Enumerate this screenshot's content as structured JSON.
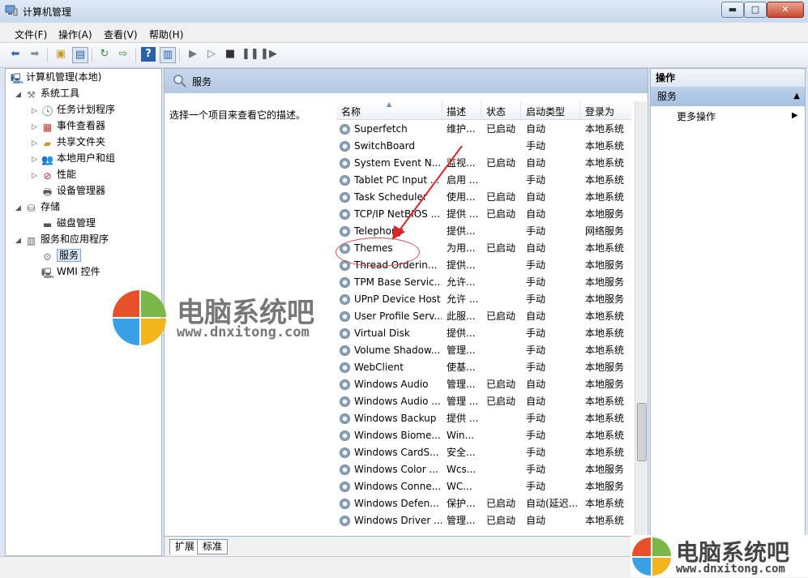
{
  "window": {
    "title": "计算机管理",
    "min_glyph": "▬",
    "max_glyph": "□",
    "close_glyph": "✕"
  },
  "menu": [
    "文件(F)",
    "操作(A)",
    "查看(V)",
    "帮助(H)"
  ],
  "tree": {
    "root": "计算机管理(本地)",
    "system_tools": "系统工具",
    "task_scheduler": "任务计划程序",
    "event_viewer": "事件查看器",
    "shared_folders": "共享文件夹",
    "local_users": "本地用户和组",
    "performance": "性能",
    "device_manager": "设备管理器",
    "storage": "存储",
    "disk_management": "磁盘管理",
    "services_apps": "服务和应用程序",
    "services": "服务",
    "wmi": "WMI 控件"
  },
  "center": {
    "header_title": "服务",
    "description": "选择一个项目来查看它的描述。",
    "columns": [
      "名称",
      "描述",
      "状态",
      "启动类型",
      "登录为"
    ],
    "rows": [
      [
        "Superfetch",
        "维护...",
        "已启动",
        "自动",
        "本地系统"
      ],
      [
        "SwitchBoard",
        "",
        "",
        "手动",
        "本地系统"
      ],
      [
        "System Event N...",
        "监视...",
        "已启动",
        "自动",
        "本地系统"
      ],
      [
        "Tablet PC Input ...",
        "启用 ...",
        "",
        "手动",
        "本地系统"
      ],
      [
        "Task Scheduler",
        "使用...",
        "已启动",
        "自动",
        "本地系统"
      ],
      [
        "TCP/IP NetBIOS ...",
        "提供 ...",
        "已启动",
        "自动",
        "本地服务"
      ],
      [
        "Telephony",
        "提供...",
        "",
        "手动",
        "网络服务"
      ],
      [
        "Themes",
        "为用...",
        "已启动",
        "自动",
        "本地系统"
      ],
      [
        "Thread Orderin...",
        "提供...",
        "",
        "手动",
        "本地服务"
      ],
      [
        "TPM Base Servic...",
        "允许...",
        "",
        "手动",
        "本地服务"
      ],
      [
        "UPnP Device Host",
        "允许 ...",
        "",
        "手动",
        "本地服务"
      ],
      [
        "User Profile Serv...",
        "此服...",
        "已启动",
        "自动",
        "本地系统"
      ],
      [
        "Virtual Disk",
        "提供...",
        "",
        "手动",
        "本地系统"
      ],
      [
        "Volume Shadow...",
        "管理...",
        "",
        "手动",
        "本地系统"
      ],
      [
        "WebClient",
        "使基...",
        "",
        "手动",
        "本地服务"
      ],
      [
        "Windows Audio",
        "管理...",
        "已启动",
        "自动",
        "本地服务"
      ],
      [
        "Windows Audio ...",
        "管理 ...",
        "已启动",
        "自动",
        "本地系统"
      ],
      [
        "Windows Backup",
        "提供 ...",
        "",
        "手动",
        "本地系统"
      ],
      [
        "Windows Biome...",
        "Win...",
        "",
        "手动",
        "本地系统"
      ],
      [
        "Windows CardS...",
        "安全...",
        "",
        "手动",
        "本地系统"
      ],
      [
        "Windows Color ...",
        "Wcs...",
        "",
        "手动",
        "本地服务"
      ],
      [
        "Windows Conne...",
        "WC...",
        "",
        "手动",
        "本地服务"
      ],
      [
        "Windows Defen...",
        "保护...",
        "已启动",
        "自动(延迟...",
        "本地系统"
      ],
      [
        "Windows Driver ...",
        "管理...",
        "已启动",
        "自动",
        "本地系统"
      ]
    ],
    "tabs": [
      "扩展",
      "标准"
    ]
  },
  "actions": {
    "header": "操作",
    "group": "服务",
    "more": "更多操作"
  },
  "watermark": {
    "title": "电脑系统吧",
    "url": "www.dnxitong.com"
  }
}
